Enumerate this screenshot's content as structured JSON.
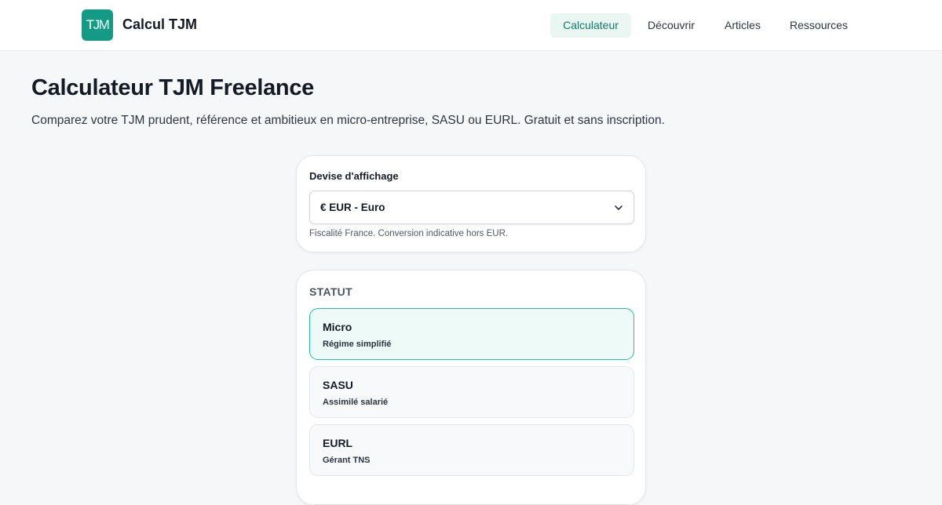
{
  "header": {
    "logo_text": "TJM",
    "brand": "Calcul TJM",
    "nav": [
      {
        "label": "Calculateur",
        "active": true
      },
      {
        "label": "Découvrir",
        "active": false
      },
      {
        "label": "Articles",
        "active": false
      },
      {
        "label": "Ressources",
        "active": false
      }
    ]
  },
  "main": {
    "title": "Calculateur TJM Freelance",
    "subtitle": "Comparez votre TJM prudent, référence et ambitieux en micro-entreprise, SASU ou EURL. Gratuit et sans inscription."
  },
  "currency": {
    "label": "Devise d'affichage",
    "selected": "€ EUR - Euro",
    "hint": "Fiscalité France. Conversion indicative hors EUR.",
    "chevron_icon": "chevron-down-icon"
  },
  "status": {
    "title": "STATUT",
    "options": [
      {
        "title": "Micro",
        "subtitle": "Régime simplifié",
        "selected": true
      },
      {
        "title": "SASU",
        "subtitle": "Assimilé salarié",
        "selected": false
      },
      {
        "title": "EURL",
        "subtitle": "Gérant TNS",
        "selected": false
      }
    ]
  },
  "colors": {
    "accent": "#149a85",
    "nav_active_bg": "#e9f6f2",
    "selected_border": "#2bb9a4",
    "page_bg": "#f6f7f8"
  }
}
